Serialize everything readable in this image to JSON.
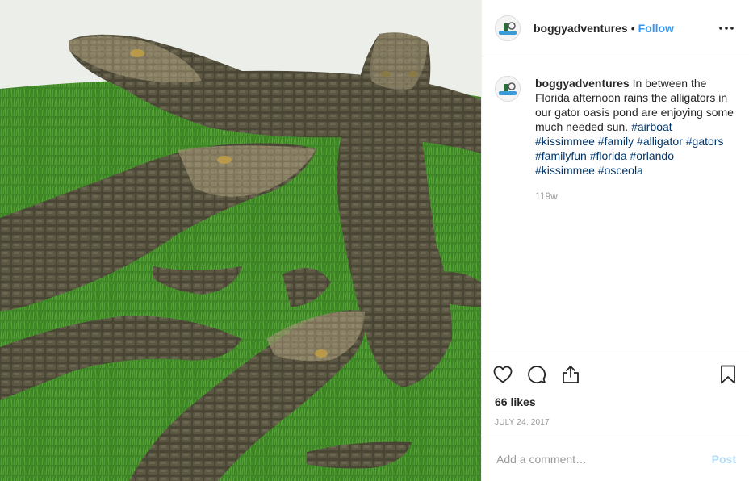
{
  "header": {
    "username": "boggyadventures",
    "separator": "•",
    "follow_label": "Follow",
    "more_icon": "ellipsis-icon"
  },
  "caption": {
    "username": "boggyadventures",
    "text": "In between the Florida afternoon rains the alligators in our gator oasis pond are enjoying some much needed sun.",
    "hashtags": [
      "#airboat",
      "#kissimmee",
      "#family",
      "#alligator",
      "#gators",
      "#familyfun",
      "#florida",
      "#orlando",
      "#kissimmee",
      "#osceola"
    ],
    "time_ago": "119w"
  },
  "actions": {
    "like_icon": "heart-icon",
    "comment_icon": "comment-icon",
    "share_icon": "share-icon",
    "save_icon": "bookmark-icon"
  },
  "likes_text": "66 likes",
  "date_text": "JULY 24, 2017",
  "comment_box": {
    "placeholder": "Add a comment…",
    "post_label": "Post"
  },
  "colors": {
    "follow": "#3897f0",
    "hashtag": "#003569",
    "post_disabled": "#b2dffc",
    "grass": "#3f8a2a",
    "gator": "#4a4636"
  }
}
